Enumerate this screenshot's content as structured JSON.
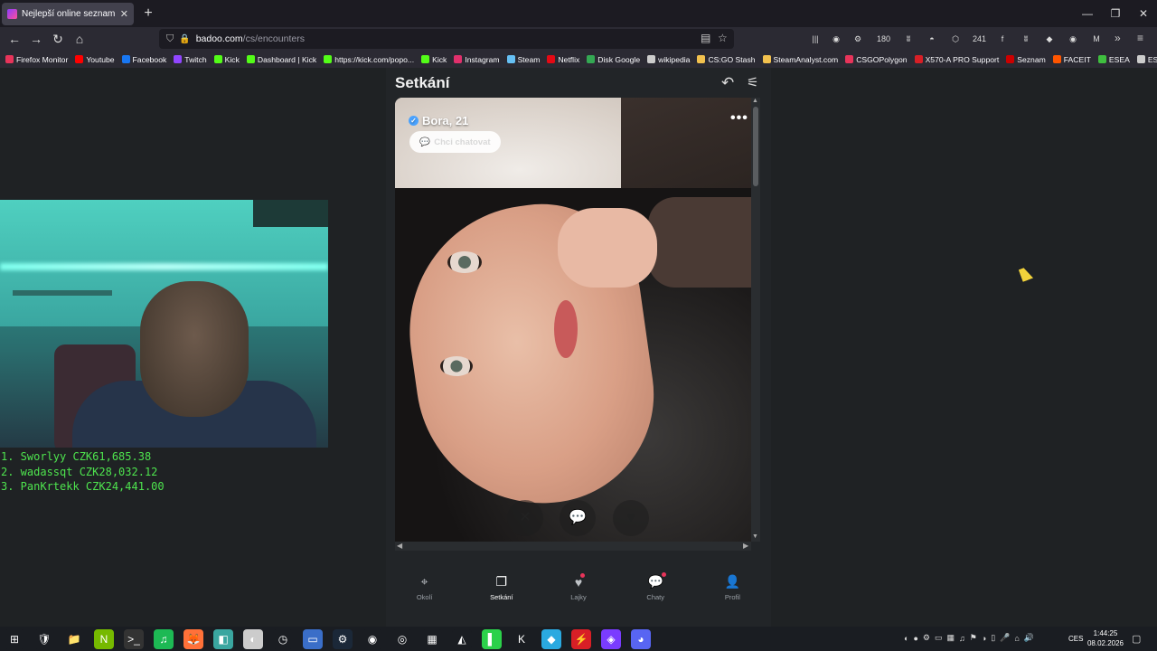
{
  "browser": {
    "tab_title": "Nejlepší online seznamka zdarm",
    "tab_close": "✕",
    "new_tab": "+",
    "window": {
      "minimize": "—",
      "maximize": "❐",
      "close": "✕"
    },
    "url_host": "badoo.com",
    "url_path": "/cs/encounters",
    "extensions": [
      {
        "label": "|||",
        "icon": "library-icon"
      },
      {
        "label": "◉",
        "icon": "account-icon"
      },
      {
        "label": "⚙",
        "icon": "steam-ext-icon"
      },
      {
        "label": "180",
        "icon": "badge-ext-icon"
      },
      {
        "label": "ʬ",
        "icon": "ext-icon"
      },
      {
        "label": "◓",
        "icon": "ext-icon"
      },
      {
        "label": "⬡",
        "icon": "extensions-icon"
      },
      {
        "label": "241",
        "icon": "badge-ext-icon"
      },
      {
        "label": "f",
        "icon": "ext-icon"
      },
      {
        "label": "ʬ",
        "icon": "ext-icon"
      },
      {
        "label": "◆",
        "icon": "ext-icon"
      },
      {
        "label": "◉",
        "icon": "ext-icon"
      },
      {
        "label": "M",
        "icon": "ext-icon"
      }
    ],
    "bookmarks": [
      {
        "label": "Firefox Monitor",
        "color": "#e8345a"
      },
      {
        "label": "Youtube",
        "color": "#ff0000"
      },
      {
        "label": "Facebook",
        "color": "#1877f2"
      },
      {
        "label": "Twitch",
        "color": "#9146ff"
      },
      {
        "label": "Kick",
        "color": "#53fc18"
      },
      {
        "label": "Dashboard | Kick",
        "color": "#53fc18"
      },
      {
        "label": "https://kick.com/popo...",
        "color": "#53fc18"
      },
      {
        "label": "Kick",
        "color": "#53fc18"
      },
      {
        "label": "Instagram",
        "color": "#e1306c"
      },
      {
        "label": "Steam",
        "color": "#66c0f4"
      },
      {
        "label": "Netflix",
        "color": "#e50914"
      },
      {
        "label": "Disk Google",
        "color": "#34a853"
      },
      {
        "label": "wikipedia",
        "color": "#cccccc"
      },
      {
        "label": "CS:GO Stash",
        "color": "#f2c14e"
      },
      {
        "label": "SteamAnalyst.com",
        "color": "#f2c14e"
      },
      {
        "label": "CSGOPolygon",
        "color": "#e8345a"
      },
      {
        "label": "X570-A PRO Support",
        "color": "#d81f26"
      },
      {
        "label": "Seznam",
        "color": "#cc0000"
      },
      {
        "label": "FACEIT",
        "color": "#ff5500"
      },
      {
        "label": "ESEA",
        "color": "#3fbf3f"
      },
      {
        "label": "ESL",
        "color": "#cccccc"
      }
    ]
  },
  "overlay": {
    "leaderboard": [
      "1. Sworlyy CZK61,685.38",
      "2. wadassqt CZK28,032.12",
      "3. PanKrtekk CZK24,441.00"
    ]
  },
  "encounters": {
    "title": "Setkání",
    "profile_name": "Bora, 21",
    "chat_button": "Chci chatovat",
    "more": "•••",
    "actions": [
      {
        "name": "dislike-button",
        "label": "✕"
      },
      {
        "name": "chat-action-button",
        "label": "💬"
      },
      {
        "name": "like-button",
        "label": "♥"
      }
    ]
  },
  "bottom_nav": [
    {
      "label": "Okolí",
      "icon": "⌖",
      "name": "nav-okoli",
      "active": false,
      "dot": false
    },
    {
      "label": "Setkání",
      "icon": "❐",
      "name": "nav-setkani",
      "active": true,
      "dot": false
    },
    {
      "label": "Lajky",
      "icon": "♥",
      "name": "nav-lajky",
      "active": false,
      "dot": true
    },
    {
      "label": "Chaty",
      "icon": "💬",
      "name": "nav-chaty",
      "active": false,
      "dot": true
    },
    {
      "label": "Profil",
      "icon": "👤",
      "name": "nav-profil",
      "active": false,
      "dot": false
    }
  ],
  "taskbar": {
    "apps": [
      {
        "label": "⊞",
        "name": "start-button",
        "color": "#1a1d22"
      },
      {
        "label": "🛡",
        "name": "security-app",
        "color": "#1a1d22"
      },
      {
        "label": "📁",
        "name": "file-explorer-app",
        "color": "#1a1d22"
      },
      {
        "label": "N",
        "name": "nvidia-app",
        "color": "#76b900"
      },
      {
        "label": ">_",
        "name": "terminal-app",
        "color": "#333333"
      },
      {
        "label": "♫",
        "name": "spotify-app",
        "color": "#1db954"
      },
      {
        "label": "🦊",
        "name": "firefox-app",
        "color": "#ff7139"
      },
      {
        "label": "◧",
        "name": "app-8",
        "color": "#3aa6a0"
      },
      {
        "label": "◐",
        "name": "app-9",
        "color": "#cccccc"
      },
      {
        "label": "◷",
        "name": "clock-app",
        "color": "#1a1d22"
      },
      {
        "label": "▭",
        "name": "display-app",
        "color": "#3a6ec8"
      },
      {
        "label": "⚙",
        "name": "steam-app",
        "color": "#1b2838"
      },
      {
        "label": "◉",
        "name": "app-13",
        "color": "#1a1d22"
      },
      {
        "label": "◎",
        "name": "app-14",
        "color": "#1a1d22"
      },
      {
        "label": "▦",
        "name": "calculator-app",
        "color": "#1a1d22"
      },
      {
        "label": "◭",
        "name": "app-16",
        "color": "#1a1d22"
      },
      {
        "label": "▌",
        "name": "app-17",
        "color": "#2bd14a"
      },
      {
        "label": "K",
        "name": "kick-app",
        "color": "#1a1d22"
      },
      {
        "label": "◆",
        "name": "app-19",
        "color": "#2aa9e0"
      },
      {
        "label": "⚡",
        "name": "app-20",
        "color": "#d81f26"
      },
      {
        "label": "◈",
        "name": "app-21",
        "color": "#7a3cff"
      },
      {
        "label": "◕",
        "name": "discord-app",
        "color": "#5865f2"
      }
    ],
    "tray_icons": [
      "◐",
      "●",
      "⚙",
      "▭",
      "▦",
      "♫",
      "⚑",
      "◑",
      "▯",
      "🎤",
      "⌂",
      "🔊"
    ],
    "language": "CES",
    "time": "1:44:25",
    "date": "08.02.2026",
    "notification": "▢"
  }
}
